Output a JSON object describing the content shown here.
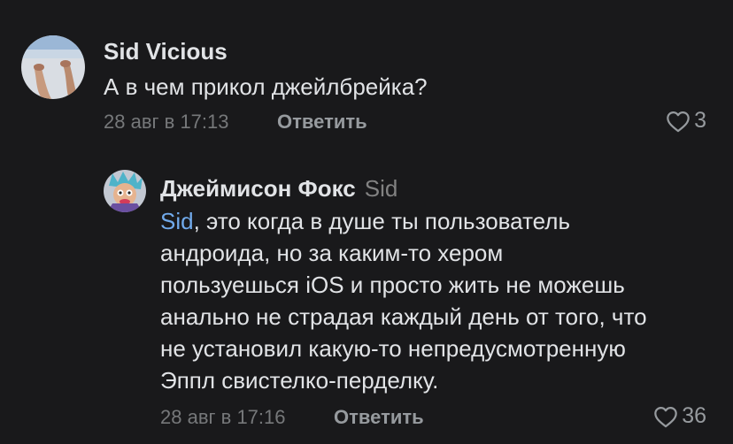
{
  "comments": [
    {
      "author": "Sid Vicious",
      "text": "А в чем прикол джейлбрейка?",
      "date": "28 авг в 17:13",
      "reply_label": "Ответить",
      "likes": "3"
    },
    {
      "author": "Джеймисон Фокс",
      "reply_to": "Sid",
      "mention": "Sid",
      "text_lines": [
        ", это когда в душе ты пользователь",
        "андроида, но за каким-то хером",
        "пользуешься iOS и просто жить не можешь",
        "анально не страдая каждый день от того, что",
        "не установил какую-то непредусмотренную",
        "Эппл свистелко-перделку."
      ],
      "date": "28 авг в 17:16",
      "reply_label": "Ответить",
      "likes": "36"
    }
  ],
  "colors": {
    "background": "#19191b",
    "text": "#e1e3e6",
    "secondary": "#76787a",
    "mention": "#71aaeb"
  },
  "icons": {
    "like": "heart-outline-icon"
  }
}
